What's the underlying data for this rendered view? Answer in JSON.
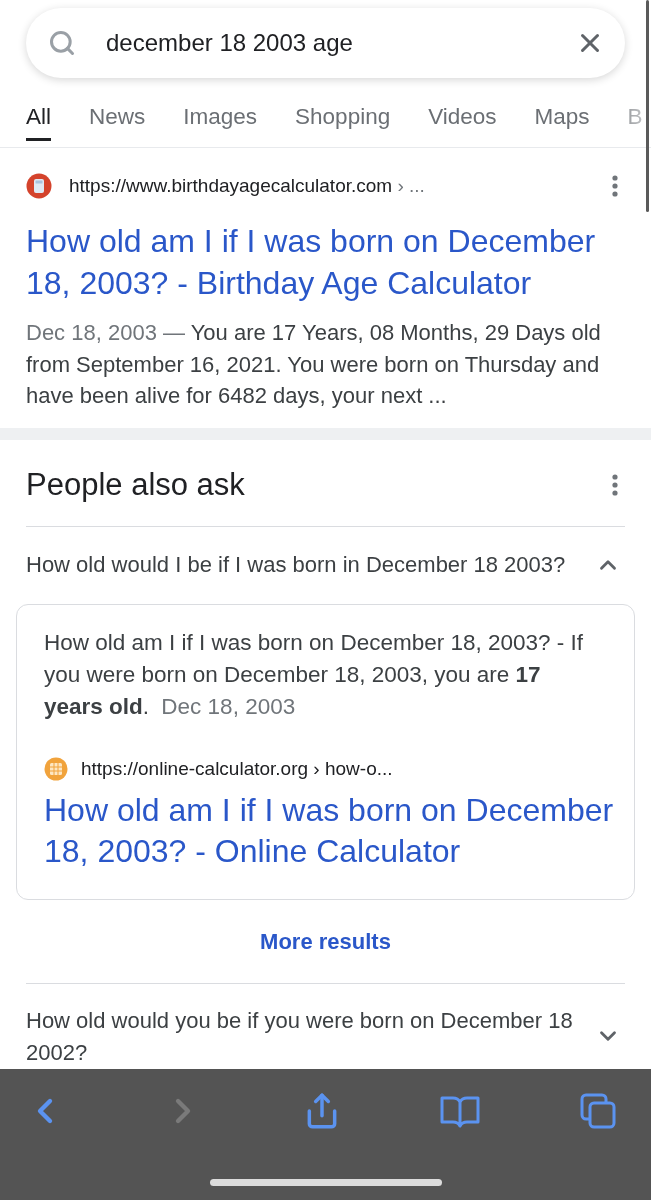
{
  "search": {
    "value": "december 18 2003 age"
  },
  "tabs": [
    {
      "label": "All",
      "selected": true
    },
    {
      "label": "News",
      "selected": false
    },
    {
      "label": "Images",
      "selected": false
    },
    {
      "label": "Shopping",
      "selected": false
    },
    {
      "label": "Videos",
      "selected": false
    },
    {
      "label": "Maps",
      "selected": false
    },
    {
      "label": "B",
      "selected": false
    }
  ],
  "result": {
    "url": "https://www.birthdayagecalculator.com",
    "path": "› ...",
    "title": "How old am I if I was born on December 18, 2003? - Birthday Age Calculator",
    "date": "Dec 18, 2003 —",
    "snippet": "You are 17 Years, 08 Months, 29 Days old from September 16, 2021. You were born on Thursday and have been alive for 6482 days, your next ..."
  },
  "people_also_ask": {
    "heading": "People also ask",
    "questions": [
      {
        "question": "How old would I be if I was born in December 18 2003?",
        "expanded": true,
        "answer": {
          "text": "How old am I if I was born on December 18, 2003? - If you were born on December 18, 2003, you are **17 years old**.",
          "date": "Dec 18, 2003",
          "source_url": "https://online-calculator.org",
          "source_path": "› how-o...",
          "source_title": "How old am I if I was born on December 18, 2003? - Online Calculator",
          "more": "More results"
        }
      },
      {
        "question": "How old would you be if you were born on December 18 2002?",
        "expanded": false
      }
    ]
  },
  "toolbar": {
    "back": {
      "disabled": false
    },
    "forward": {
      "disabled": true
    }
  }
}
